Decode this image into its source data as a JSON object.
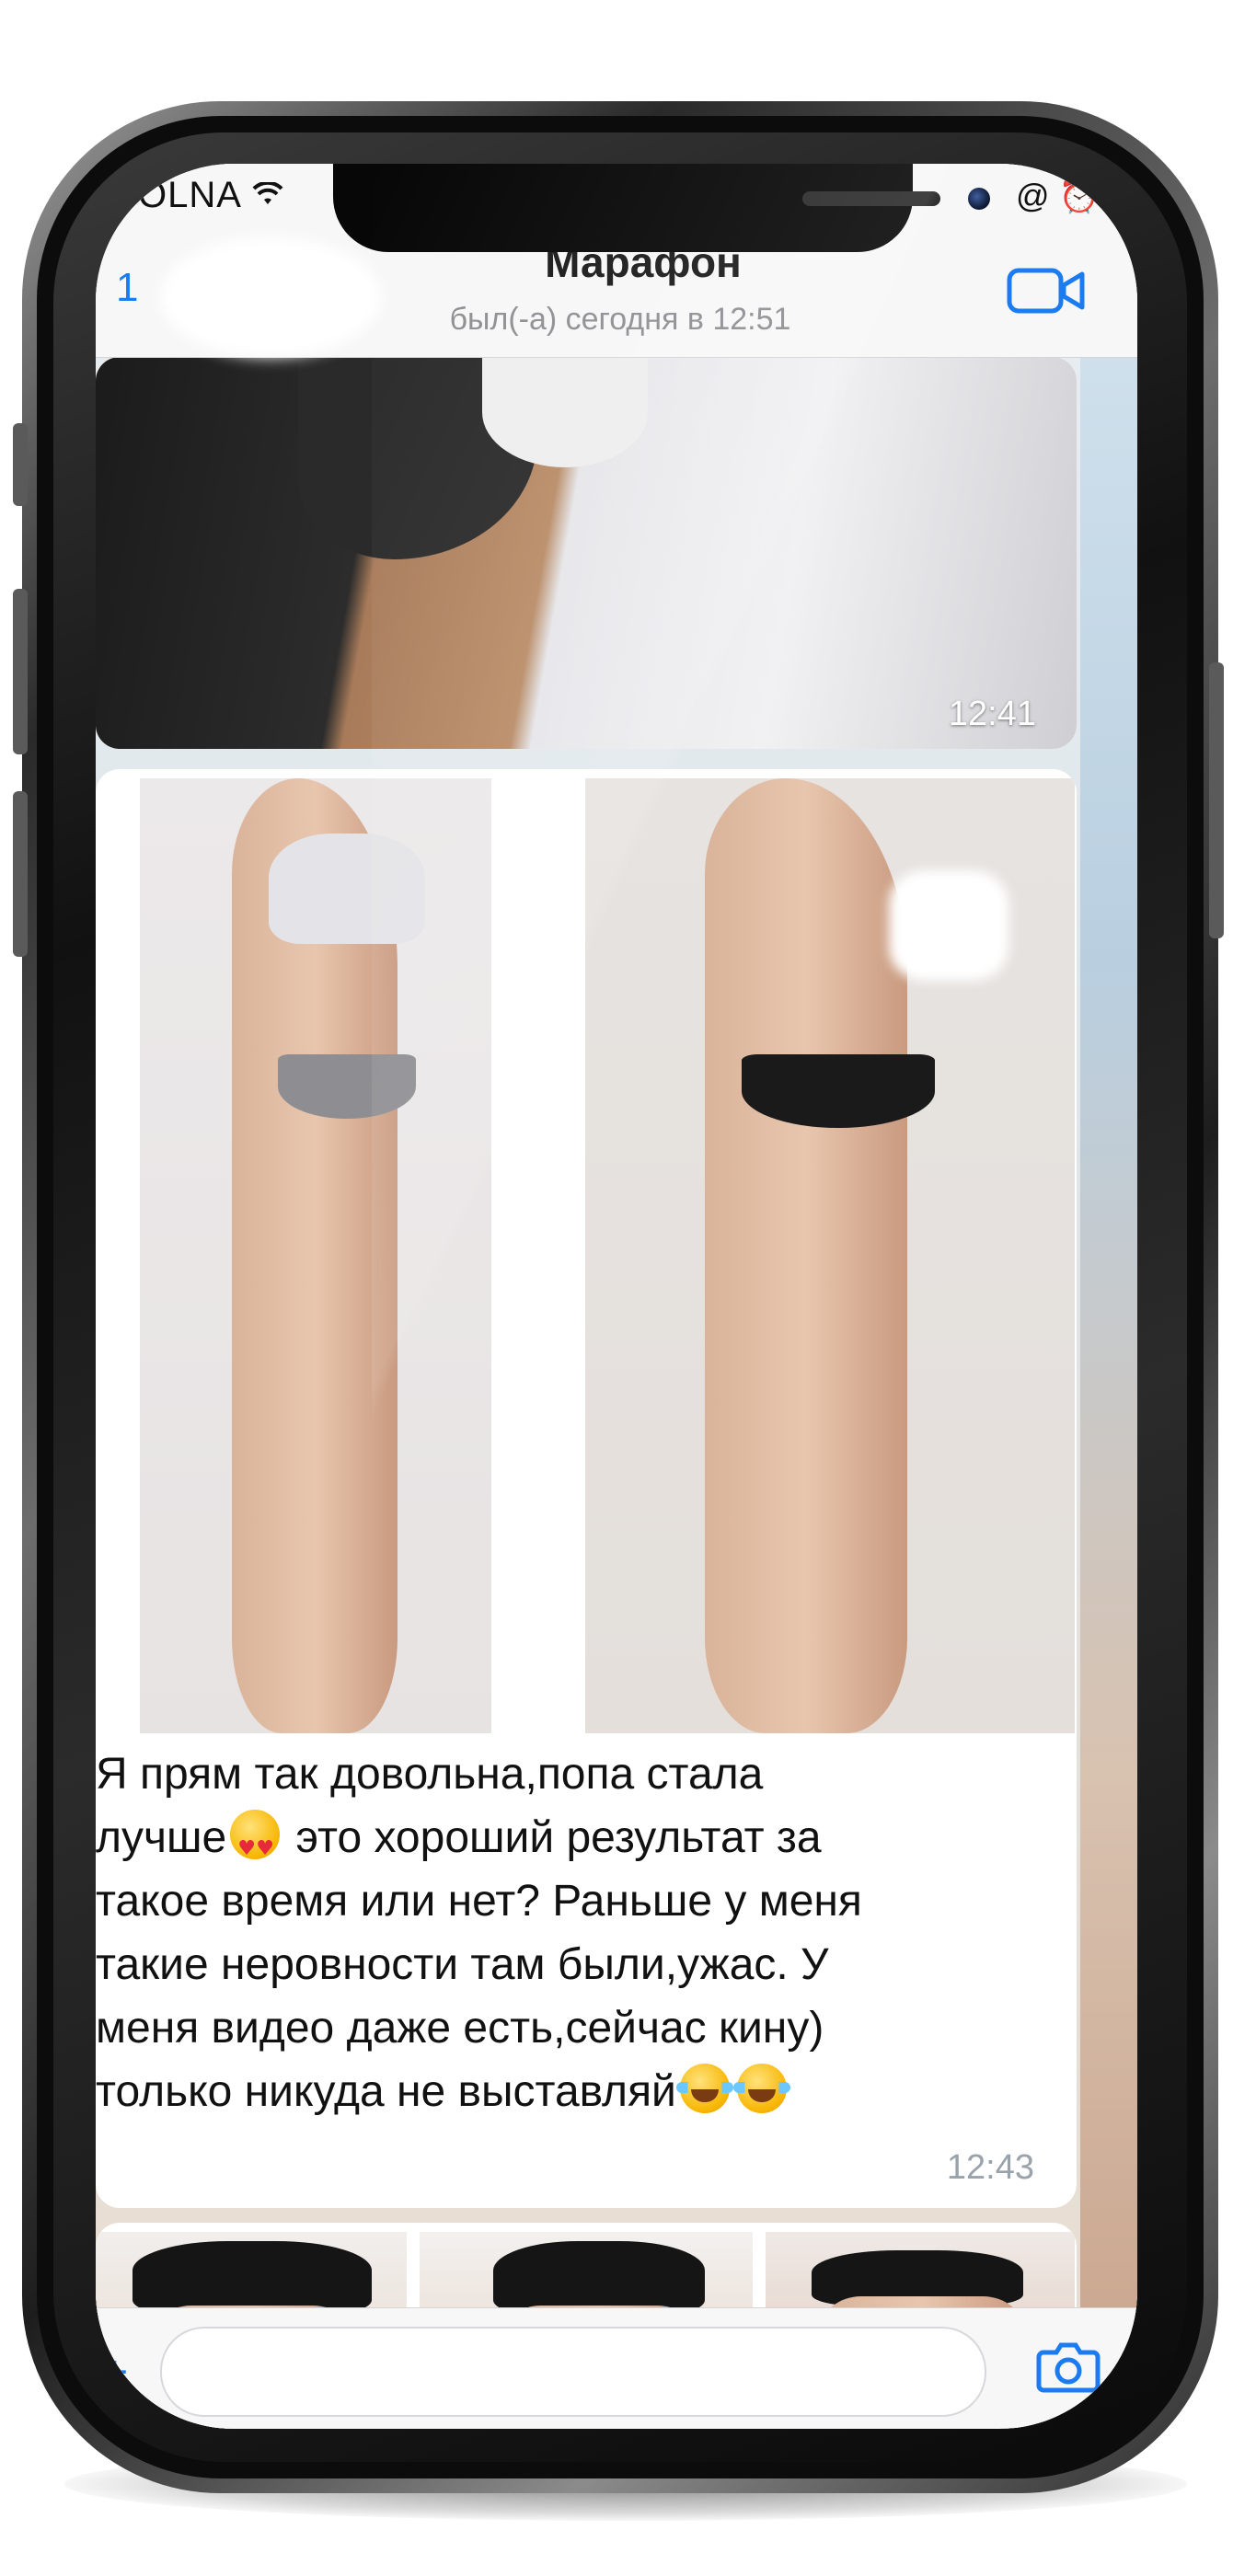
{
  "status_bar": {
    "carrier": "OLNA",
    "wifi_icon": "wifi-icon",
    "right_icons": "@ ⏰"
  },
  "header": {
    "back_count": "1",
    "title": "Марафон",
    "subtitle": "был(-а) сегодня в 12:51",
    "video_icon": "video-call-icon"
  },
  "messages": [
    {
      "type": "photo",
      "time": "12:41"
    },
    {
      "type": "photo-with-caption",
      "lines": [
        "Я прям так довольна,попа стала",
        "лучше",
        " это хороший результат за",
        "такое время или нет? Раньше у меня",
        "такие неровности там были,ужас. У",
        "меня видео даже есть,сейчас кину)",
        "только никуда не выставляй"
      ],
      "emoji_1": "heart-eyes-emoji",
      "emoji_2": "tears-of-joy-emoji",
      "time": "12:43"
    },
    {
      "type": "photo-collage"
    }
  ],
  "input": {
    "placeholder": "",
    "camera_icon": "camera-icon",
    "plus_icon": "plus-icon"
  },
  "colors": {
    "accent": "#1b7cf2",
    "bubble": "#ffffff",
    "navbar": "#f7f7f8",
    "timestamp": "#9aa3ab"
  }
}
